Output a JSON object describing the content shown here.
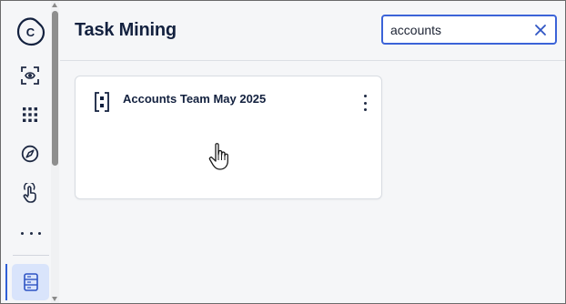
{
  "header": {
    "title": "Task Mining"
  },
  "search": {
    "value": "accounts",
    "placeholder": ""
  },
  "sidebar": {
    "logo_letter": "C",
    "items": [
      {
        "icon": "process-scan-icon"
      },
      {
        "icon": "apps-grid-icon"
      },
      {
        "icon": "compass-icon"
      },
      {
        "icon": "touch-icon"
      },
      {
        "icon": "more-icon"
      },
      {
        "icon": "task-list-icon",
        "active": true
      }
    ]
  },
  "cards": [
    {
      "title": "Accounts Team May 2025",
      "icon": "task-mining-project-icon"
    }
  ],
  "colors": {
    "accent": "#3b63d8",
    "title": "#13213f",
    "active_bg": "#d9e4fb"
  }
}
